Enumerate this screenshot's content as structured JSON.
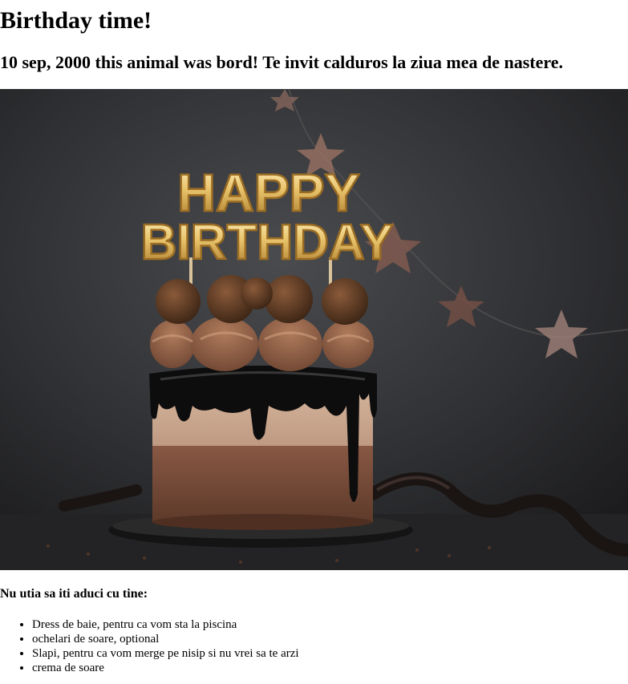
{
  "page": {
    "title": "Birthday time!",
    "subtitle": "10 sep, 2000 this animal was bord! Te invit calduros la ziua mea de nastere."
  },
  "photo": {
    "topper_line1": "HAPPY",
    "topper_line2": "BIRTHDAY",
    "colors": {
      "background": "#2a2b2d",
      "gold": "#e8c36a",
      "chocolate": "#6b4330",
      "glaze": "#0d0d0d"
    }
  },
  "bring": {
    "heading": "Nu utia sa iti aduci cu tine:",
    "items": [
      "Dress de baie, pentru ca vom sta la piscina",
      "ochelari de soare, optional",
      "Slapi, pentru ca vom merge pe nisip si nu vrei sa te arzi",
      "crema de soare"
    ]
  }
}
